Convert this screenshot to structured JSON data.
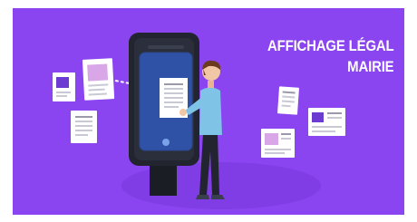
{
  "banner": {
    "title_line1": "AFFICHAGE LÉGAL",
    "title_line2": "MAIRIE",
    "colors": {
      "background": "#8a44f0",
      "kiosk": "#22252f",
      "screen": "#3052a6",
      "shirt": "#7fc4e6",
      "document_accent": "#b97ed6"
    }
  }
}
